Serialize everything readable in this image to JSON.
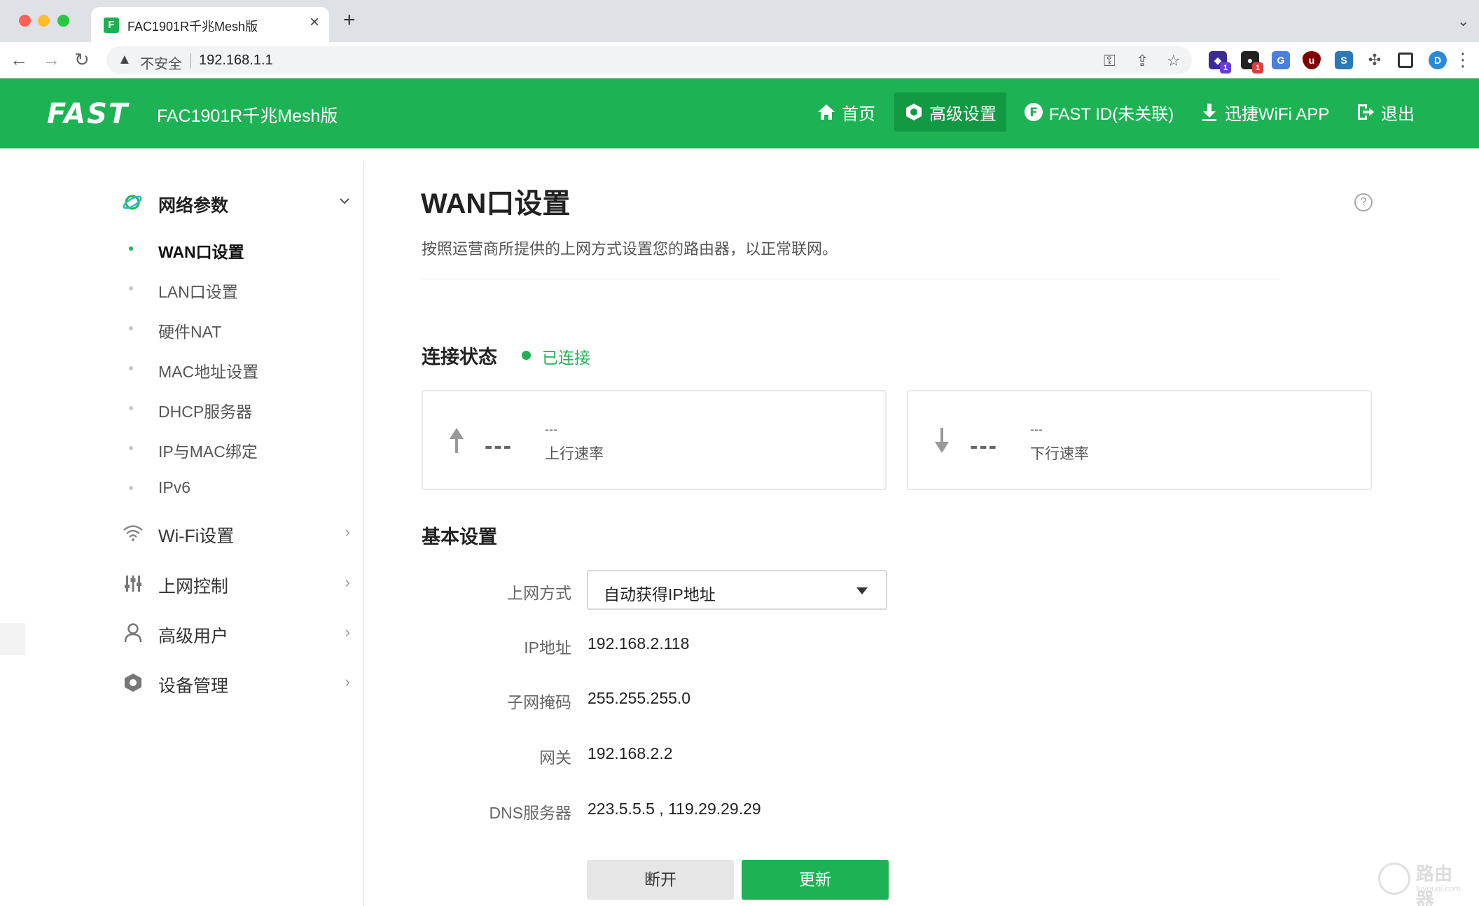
{
  "browser": {
    "tab_title": "FAC1901R千兆Mesh版",
    "tab_favicon": "F",
    "insecure_label": "不安全",
    "url": "192.168.1.1",
    "extensions": [
      {
        "name": "extension-icon-1",
        "badge": "1",
        "color": "#3b2a8f"
      },
      {
        "name": "extension-icon-2",
        "badge": "1",
        "color": "#222222"
      },
      {
        "name": "translate-icon",
        "badge": "",
        "color": "#4a7fdc"
      },
      {
        "name": "ublock-icon",
        "badge": "",
        "color": "#800000"
      },
      {
        "name": "extension-icon-s",
        "badge": "",
        "color": "#2a7ab8"
      },
      {
        "name": "puzzle-icon",
        "badge": "",
        "color": "#555555"
      }
    ]
  },
  "header": {
    "logo": "FAST",
    "model": "FAC1901R千兆Mesh版",
    "nav": [
      {
        "label": "首页",
        "icon": "home-icon"
      },
      {
        "label": "高级设置",
        "icon": "hexagon-gear-icon",
        "active": true
      },
      {
        "label": "FAST ID(未关联)",
        "icon": "fast-id-icon"
      },
      {
        "label": "迅捷WiFi APP",
        "icon": "download-icon"
      },
      {
        "label": "退出",
        "icon": "logout-icon"
      }
    ]
  },
  "sidebar": {
    "top_group": {
      "label": "网络参数",
      "icon": "planet-icon"
    },
    "sub_items": [
      {
        "label": "WAN口设置",
        "active": true
      },
      {
        "label": "LAN口设置"
      },
      {
        "label": "硬件NAT"
      },
      {
        "label": "MAC地址设置"
      },
      {
        "label": "DHCP服务器"
      },
      {
        "label": "IP与MAC绑定"
      },
      {
        "label": "IPv6"
      }
    ],
    "groups": [
      {
        "label": "Wi-Fi设置",
        "icon": "wifi-icon"
      },
      {
        "label": "上网控制",
        "icon": "sliders-icon"
      },
      {
        "label": "高级用户",
        "icon": "user-icon"
      },
      {
        "label": "设备管理",
        "icon": "hexagon-icon"
      }
    ]
  },
  "main": {
    "title": "WAN口设置",
    "description": "按照运营商所提供的上网方式设置您的路由器，以正常联网。",
    "connection": {
      "title": "连接状态",
      "status": "已连接",
      "upload": {
        "big": "---",
        "small": "---",
        "label": "上行速率"
      },
      "download": {
        "big": "---",
        "small": "---",
        "label": "下行速率"
      }
    },
    "basic": {
      "title": "基本设置",
      "fields": [
        {
          "label": "上网方式",
          "value": "自动获得IP地址"
        },
        {
          "label": "IP地址",
          "value": "192.168.2.118"
        },
        {
          "label": "子网掩码",
          "value": "255.255.255.0"
        },
        {
          "label": "网关",
          "value": "192.168.2.2"
        },
        {
          "label": "DNS服务器",
          "value": "223.5.5.5 , 119.29.29.29"
        }
      ]
    },
    "buttons": {
      "disconnect": "断开",
      "renew": "更新"
    }
  },
  "watermark": {
    "cn": "路由器",
    "en": "luyouqi.com"
  },
  "colors": {
    "brand_green": "#1db354",
    "active_nav_bg": "#129943"
  }
}
